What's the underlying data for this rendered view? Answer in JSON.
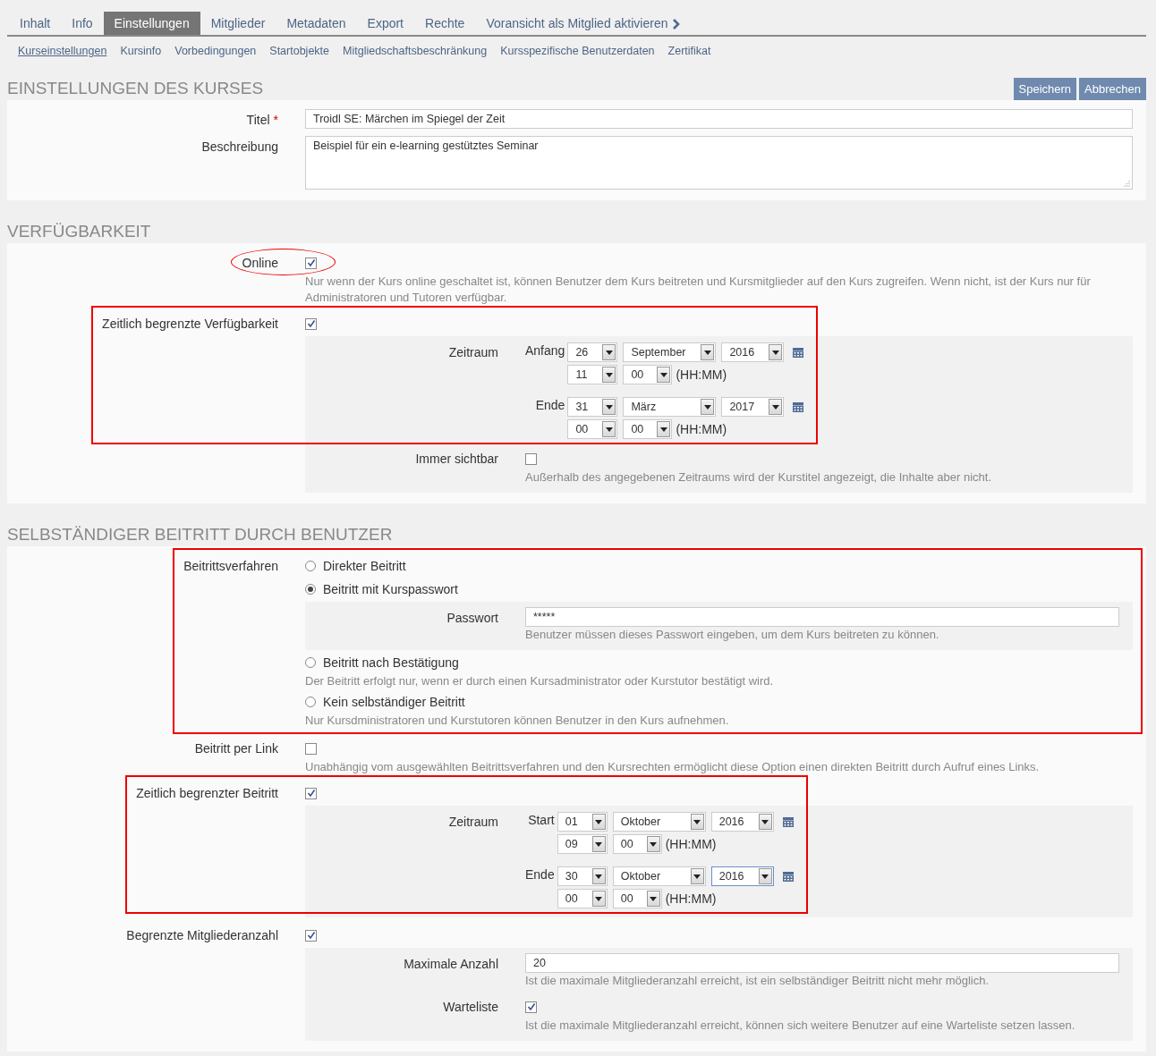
{
  "tabs": [
    {
      "label": "Inhalt",
      "selected": false,
      "kind": "tab"
    },
    {
      "label": "Info",
      "selected": false,
      "kind": "tab"
    },
    {
      "label": "Einstellungen",
      "selected": true,
      "kind": "tab"
    },
    {
      "label": "Mitglieder",
      "selected": false,
      "kind": "tab"
    },
    {
      "label": "Metadaten",
      "selected": false,
      "kind": "tab"
    },
    {
      "label": "Export",
      "selected": false,
      "kind": "tab"
    },
    {
      "label": "Rechte",
      "selected": false,
      "kind": "tab"
    },
    {
      "label": "Voransicht als Mitglied aktivieren",
      "selected": false,
      "kind": "action"
    }
  ],
  "subtabs": [
    {
      "label": "Kurseinstellungen",
      "selected": true
    },
    {
      "label": "Kursinfo",
      "selected": false
    },
    {
      "label": "Vorbedingungen",
      "selected": false
    },
    {
      "label": "Startobjekte",
      "selected": false
    },
    {
      "label": "Mitgliedschaftsbeschränkung",
      "selected": false
    },
    {
      "label": "Kursspezifische Benutzerdaten",
      "selected": false
    },
    {
      "label": "Zertifikat",
      "selected": false
    }
  ],
  "sections": [
    {
      "title": "EINSTELLUNGEN DES KURSES",
      "buttons": [
        "Speichern",
        "Abbrechen"
      ],
      "rows": [
        {
          "kind": "text",
          "label": "Titel",
          "required": true,
          "required_mark": "*",
          "value": "Troidl SE: Märchen im Spiegel der Zeit"
        },
        {
          "kind": "textarea",
          "label": "Beschreibung",
          "value": "Beispiel für ein e-learning gestütztes Seminar"
        }
      ]
    },
    {
      "title": "VERFÜGBARKEIT",
      "rows": [
        {
          "kind": "checkbox",
          "label": "Online",
          "checked": true,
          "circled": true,
          "highlighted": false,
          "info": "Nur wenn der Kurs online geschaltet ist, können Benutzer dem Kurs beitreten und Kursmitglieder auf den Kurs zugreifen. Wenn nicht, ist der Kurs nur für Administratoren und Tutoren verfügbar."
        },
        {
          "kind": "checkbox",
          "label": "Zeitlich begrenzte Verfügbarkeit",
          "checked": true,
          "circled": false,
          "highlighted": true,
          "children": [
            {
              "kind": "daterange",
              "label": "Zeitraum",
              "entries": [
                {
                  "label": "Anfang",
                  "day": "26",
                  "month": "September",
                  "year": "2016",
                  "hour": "11",
                  "minute": "00",
                  "time_hint": "(HH:MM)"
                },
                {
                  "label": "Ende",
                  "day": "31",
                  "month": "März",
                  "year": "2017",
                  "hour": "00",
                  "minute": "00",
                  "time_hint": "(HH:MM)"
                }
              ]
            },
            {
              "kind": "checkbox",
              "label": "Immer sichtbar",
              "checked": false,
              "circled": false,
              "highlighted": false,
              "info": "Außerhalb des angegebenen Zeitraums wird der Kurstitel angezeigt, die Inhalte aber nicht."
            }
          ]
        }
      ]
    },
    {
      "title": "SELBSTÄNDIGER BEITRITT DURCH BENUTZER",
      "rows": [
        {
          "kind": "radiogroup",
          "label": "Beitrittsverfahren",
          "highlighted": true,
          "options": [
            {
              "label": "Direkter Beitritt",
              "selected": false
            },
            {
              "label": "Beitritt mit Kurspasswort",
              "selected": true,
              "children": [
                {
                  "kind": "text",
                  "label": "Passwort",
                  "required": false,
                  "value": "*****",
                  "info": "Benutzer müssen dieses Passwort eingeben, um dem Kurs beitreten zu können."
                }
              ]
            },
            {
              "label": "Beitritt nach Bestätigung",
              "selected": false,
              "info": "Der Beitritt erfolgt nur, wenn er durch einen Kursadministrator oder Kurstutor bestätigt wird."
            },
            {
              "label": "Kein selbständiger Beitritt",
              "selected": false,
              "info": "Nur Kursdministratoren und Kurstutoren können Benutzer in den Kurs aufnehmen."
            }
          ]
        },
        {
          "kind": "checkbox",
          "label": "Beitritt per Link",
          "checked": false,
          "circled": false,
          "highlighted": false,
          "info": "Unabhängig vom ausgewählten Beitrittsverfahren und den Kursrechten ermöglicht diese Option einen direkten Beitritt durch Aufruf eines Links."
        },
        {
          "kind": "checkbox",
          "label": "Zeitlich begrenzter Beitritt",
          "checked": true,
          "circled": false,
          "highlighted": true,
          "children": [
            {
              "kind": "daterange",
              "label": "Zeitraum",
              "entries": [
                {
                  "label": "Start",
                  "day": "01",
                  "month": "Oktober",
                  "year": "2016",
                  "hour": "09",
                  "minute": "00",
                  "time_hint": "(HH:MM)"
                },
                {
                  "label": "Ende",
                  "day": "30",
                  "month": "Oktober",
                  "year": "2016",
                  "year_focused": true,
                  "hour": "00",
                  "minute": "00",
                  "time_hint": "(HH:MM)"
                }
              ]
            }
          ]
        },
        {
          "kind": "checkbox",
          "label": "Begrenzte Mitgliederanzahl",
          "checked": true,
          "circled": false,
          "highlighted": false,
          "children": [
            {
              "kind": "text",
              "label": "Maximale Anzahl",
              "required": false,
              "value": "20",
              "info": "Ist die maximale Mitgliederanzahl erreicht, ist ein selbständiger Beitritt nicht mehr möglich."
            },
            {
              "kind": "checkbox",
              "label": "Warteliste",
              "checked": true,
              "circled": false,
              "highlighted": false,
              "info": "Ist die maximale Mitgliederanzahl erreicht, können sich weitere Benutzer auf eine Warteliste setzen lassen."
            }
          ]
        }
      ]
    }
  ]
}
